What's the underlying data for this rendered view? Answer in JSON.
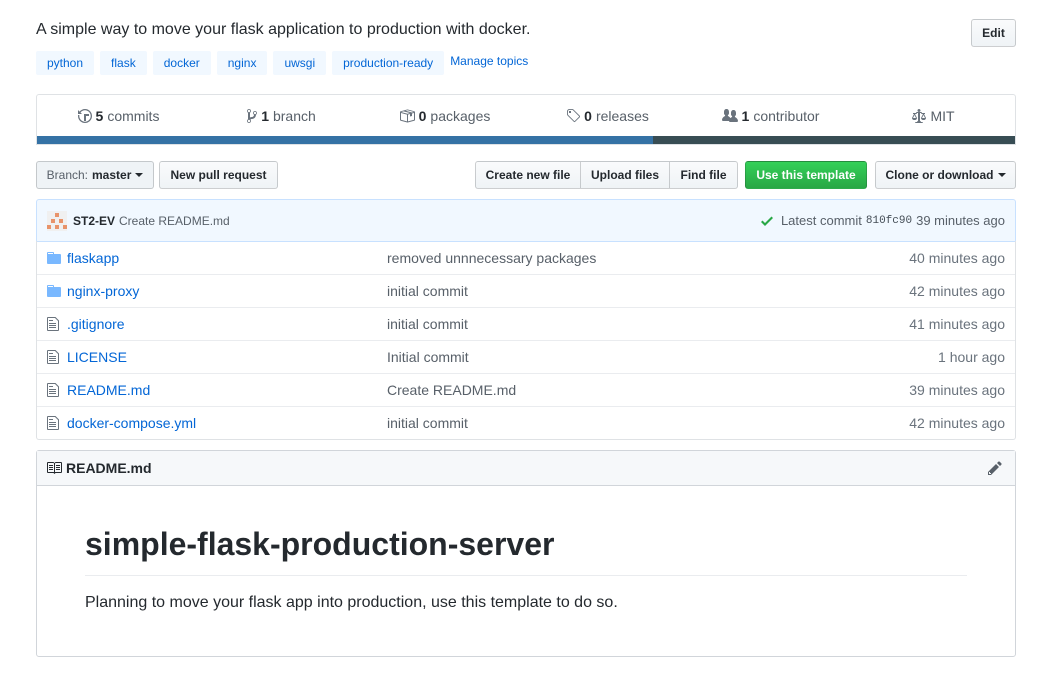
{
  "repo": {
    "description": "A simple way to move your flask application to production with docker.",
    "edit_label": "Edit",
    "topics": [
      "python",
      "flask",
      "docker",
      "nginx",
      "uwsgi",
      "production-ready"
    ],
    "manage_topics_label": "Manage topics"
  },
  "summary": {
    "commits": {
      "count": "5",
      "label": "commits",
      "icon": "history-icon"
    },
    "branches": {
      "count": "1",
      "label": "branch",
      "icon": "branch-icon"
    },
    "packages": {
      "count": "0",
      "label": "packages",
      "icon": "package-icon"
    },
    "releases": {
      "count": "0",
      "label": "releases",
      "icon": "tag-icon"
    },
    "contributors": {
      "count": "1",
      "label": "contributor",
      "icon": "people-icon"
    },
    "license": {
      "label": "MIT",
      "icon": "law-icon"
    },
    "language_bar": [
      {
        "color": "#3572A5",
        "percent": 63
      },
      {
        "color": "#384d54",
        "percent": 37
      }
    ]
  },
  "file_nav": {
    "branch_prefix": "Branch:",
    "branch_name": "master",
    "new_pull_request": "New pull request",
    "create_new_file": "Create new file",
    "upload_files": "Upload files",
    "find_file": "Find file",
    "use_template": "Use this template",
    "clone_download": "Clone or download"
  },
  "commit": {
    "author": "ST2-EV",
    "message": "Create README.md",
    "latest_label": "Latest commit",
    "sha": "810fc90",
    "age": "39 minutes ago"
  },
  "files": [
    {
      "type": "folder",
      "name": "flaskapp",
      "message": "removed unnnecessary packages",
      "age": "40 minutes ago"
    },
    {
      "type": "folder",
      "name": "nginx-proxy",
      "message": "initial commit",
      "age": "42 minutes ago"
    },
    {
      "type": "file",
      "name": ".gitignore",
      "message": "initial commit",
      "age": "41 minutes ago"
    },
    {
      "type": "file",
      "name": "LICENSE",
      "message": "Initial commit",
      "age": "1 hour ago"
    },
    {
      "type": "file",
      "name": "README.md",
      "message": "Create README.md",
      "age": "39 minutes ago"
    },
    {
      "type": "file",
      "name": "docker-compose.yml",
      "message": "initial commit",
      "age": "42 minutes ago"
    }
  ],
  "readme": {
    "filename": "README.md",
    "title": "simple-flask-production-server",
    "body": "Planning to move your flask app into production, use this template to do so."
  }
}
